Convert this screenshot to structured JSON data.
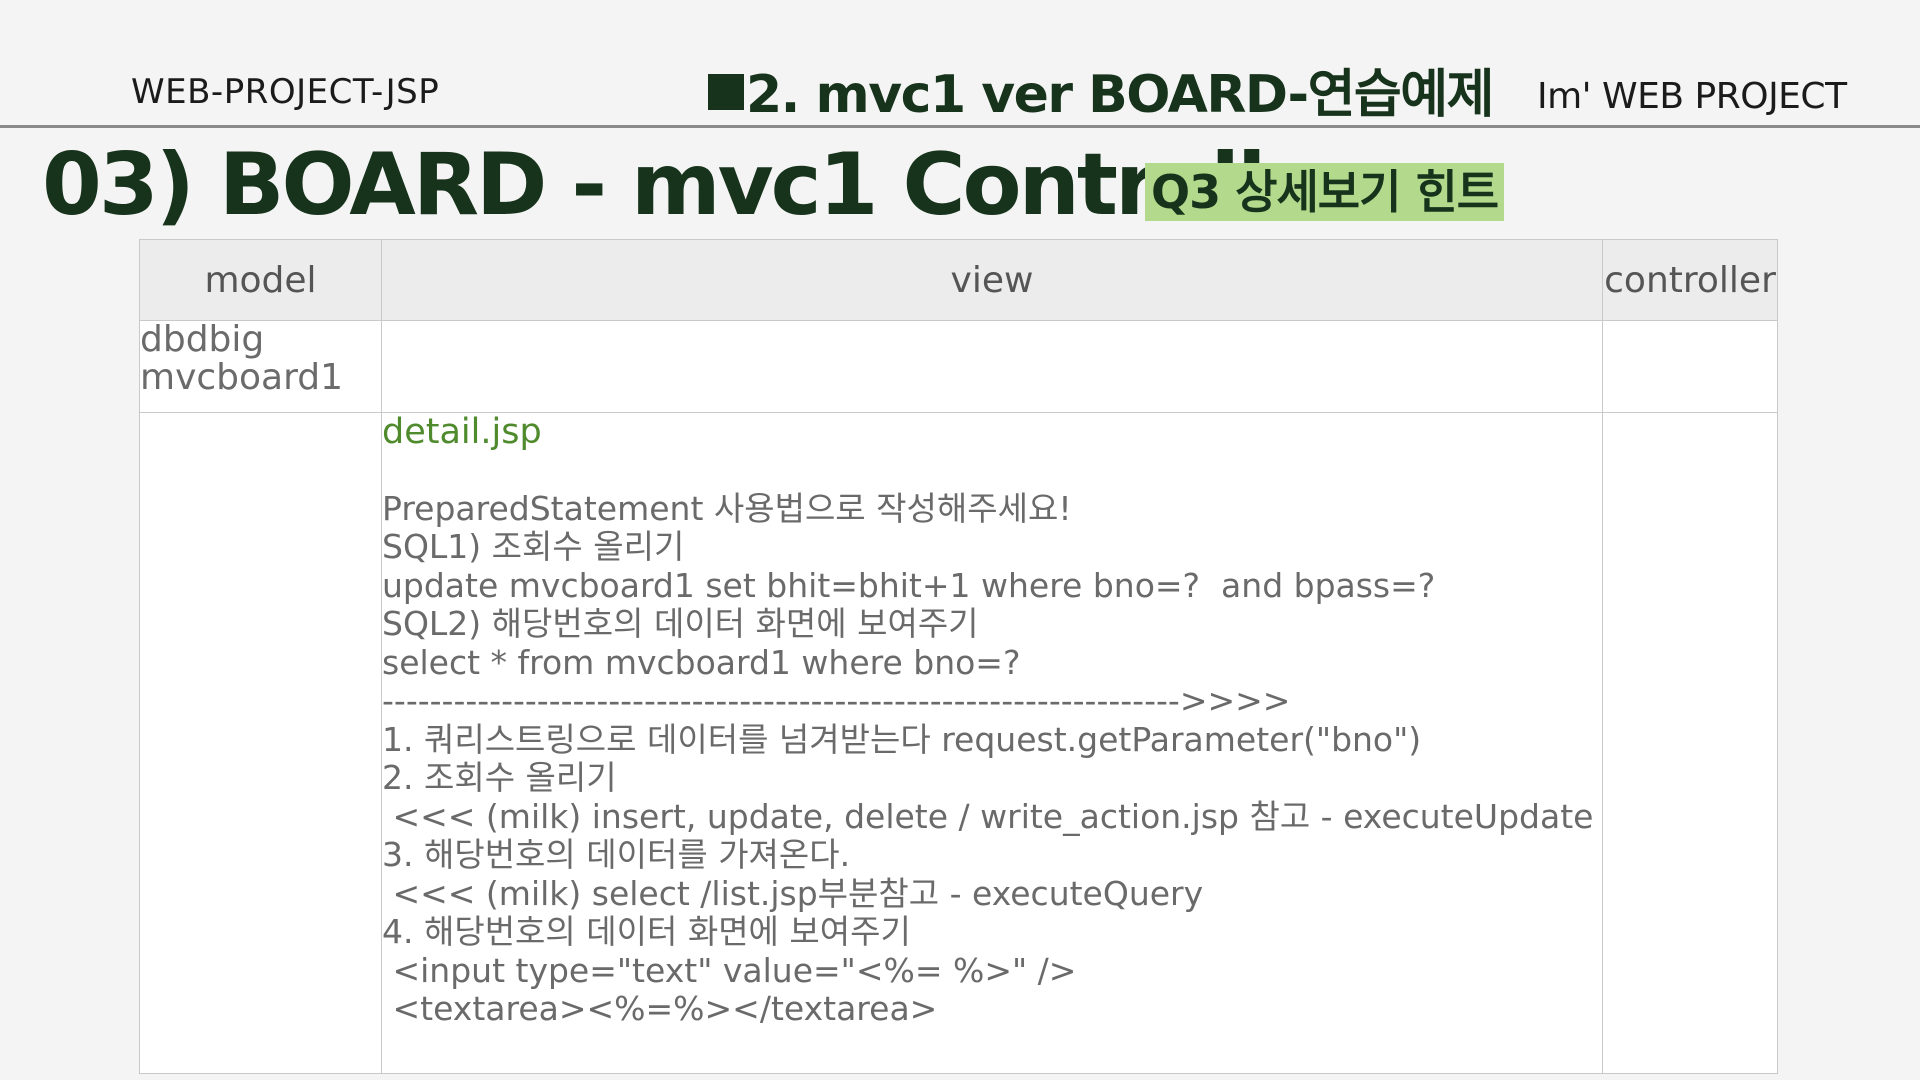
{
  "header": {
    "left_title": "WEB-PROJECT-JSP",
    "center_title": "2. mvc1 ver  BOARD-연습예제",
    "right_title": "Im'  WEB PROJECT"
  },
  "main": {
    "title": "03) BOARD - mvc1  Controller",
    "hint_badge": "Q3 상세보기 힌트"
  },
  "table": {
    "headers": {
      "model": "model",
      "view": "view",
      "controller": "controller"
    },
    "model_row": {
      "line1": "dbdbig",
      "line2": "mvcboard1"
    },
    "view_cell": {
      "file": "detail.jsp",
      "lines": [
        "PreparedStatement 사용법으로 작성해주세요!",
        "SQL1) 조회수 올리기",
        "update mvcboard1 set bhit=bhit+1 where bno=?  and bpass=?",
        "SQL2) 해당번호의 데이터 화면에 보여주기",
        "select * from mvcboard1 where bno=?",
        "------------------------------------------------------------------->>>>",
        "1. 쿼리스트링으로 데이터를 넘겨받는다 request.getParameter(\"bno\")",
        "2. 조회수 올리기",
        " <<< (milk) insert, update, delete / write_action.jsp 참고 - executeUpdate",
        "3. 해당번호의 데이터를 가져온다.",
        " <<< (milk) select /list.jsp부분참고 - executeQuery",
        "4. 해당번호의 데이터 화면에 보여주기",
        " <input type=\"text\" value=\"<%= %>\" />",
        " <textarea><%=%></textarea>"
      ]
    }
  }
}
